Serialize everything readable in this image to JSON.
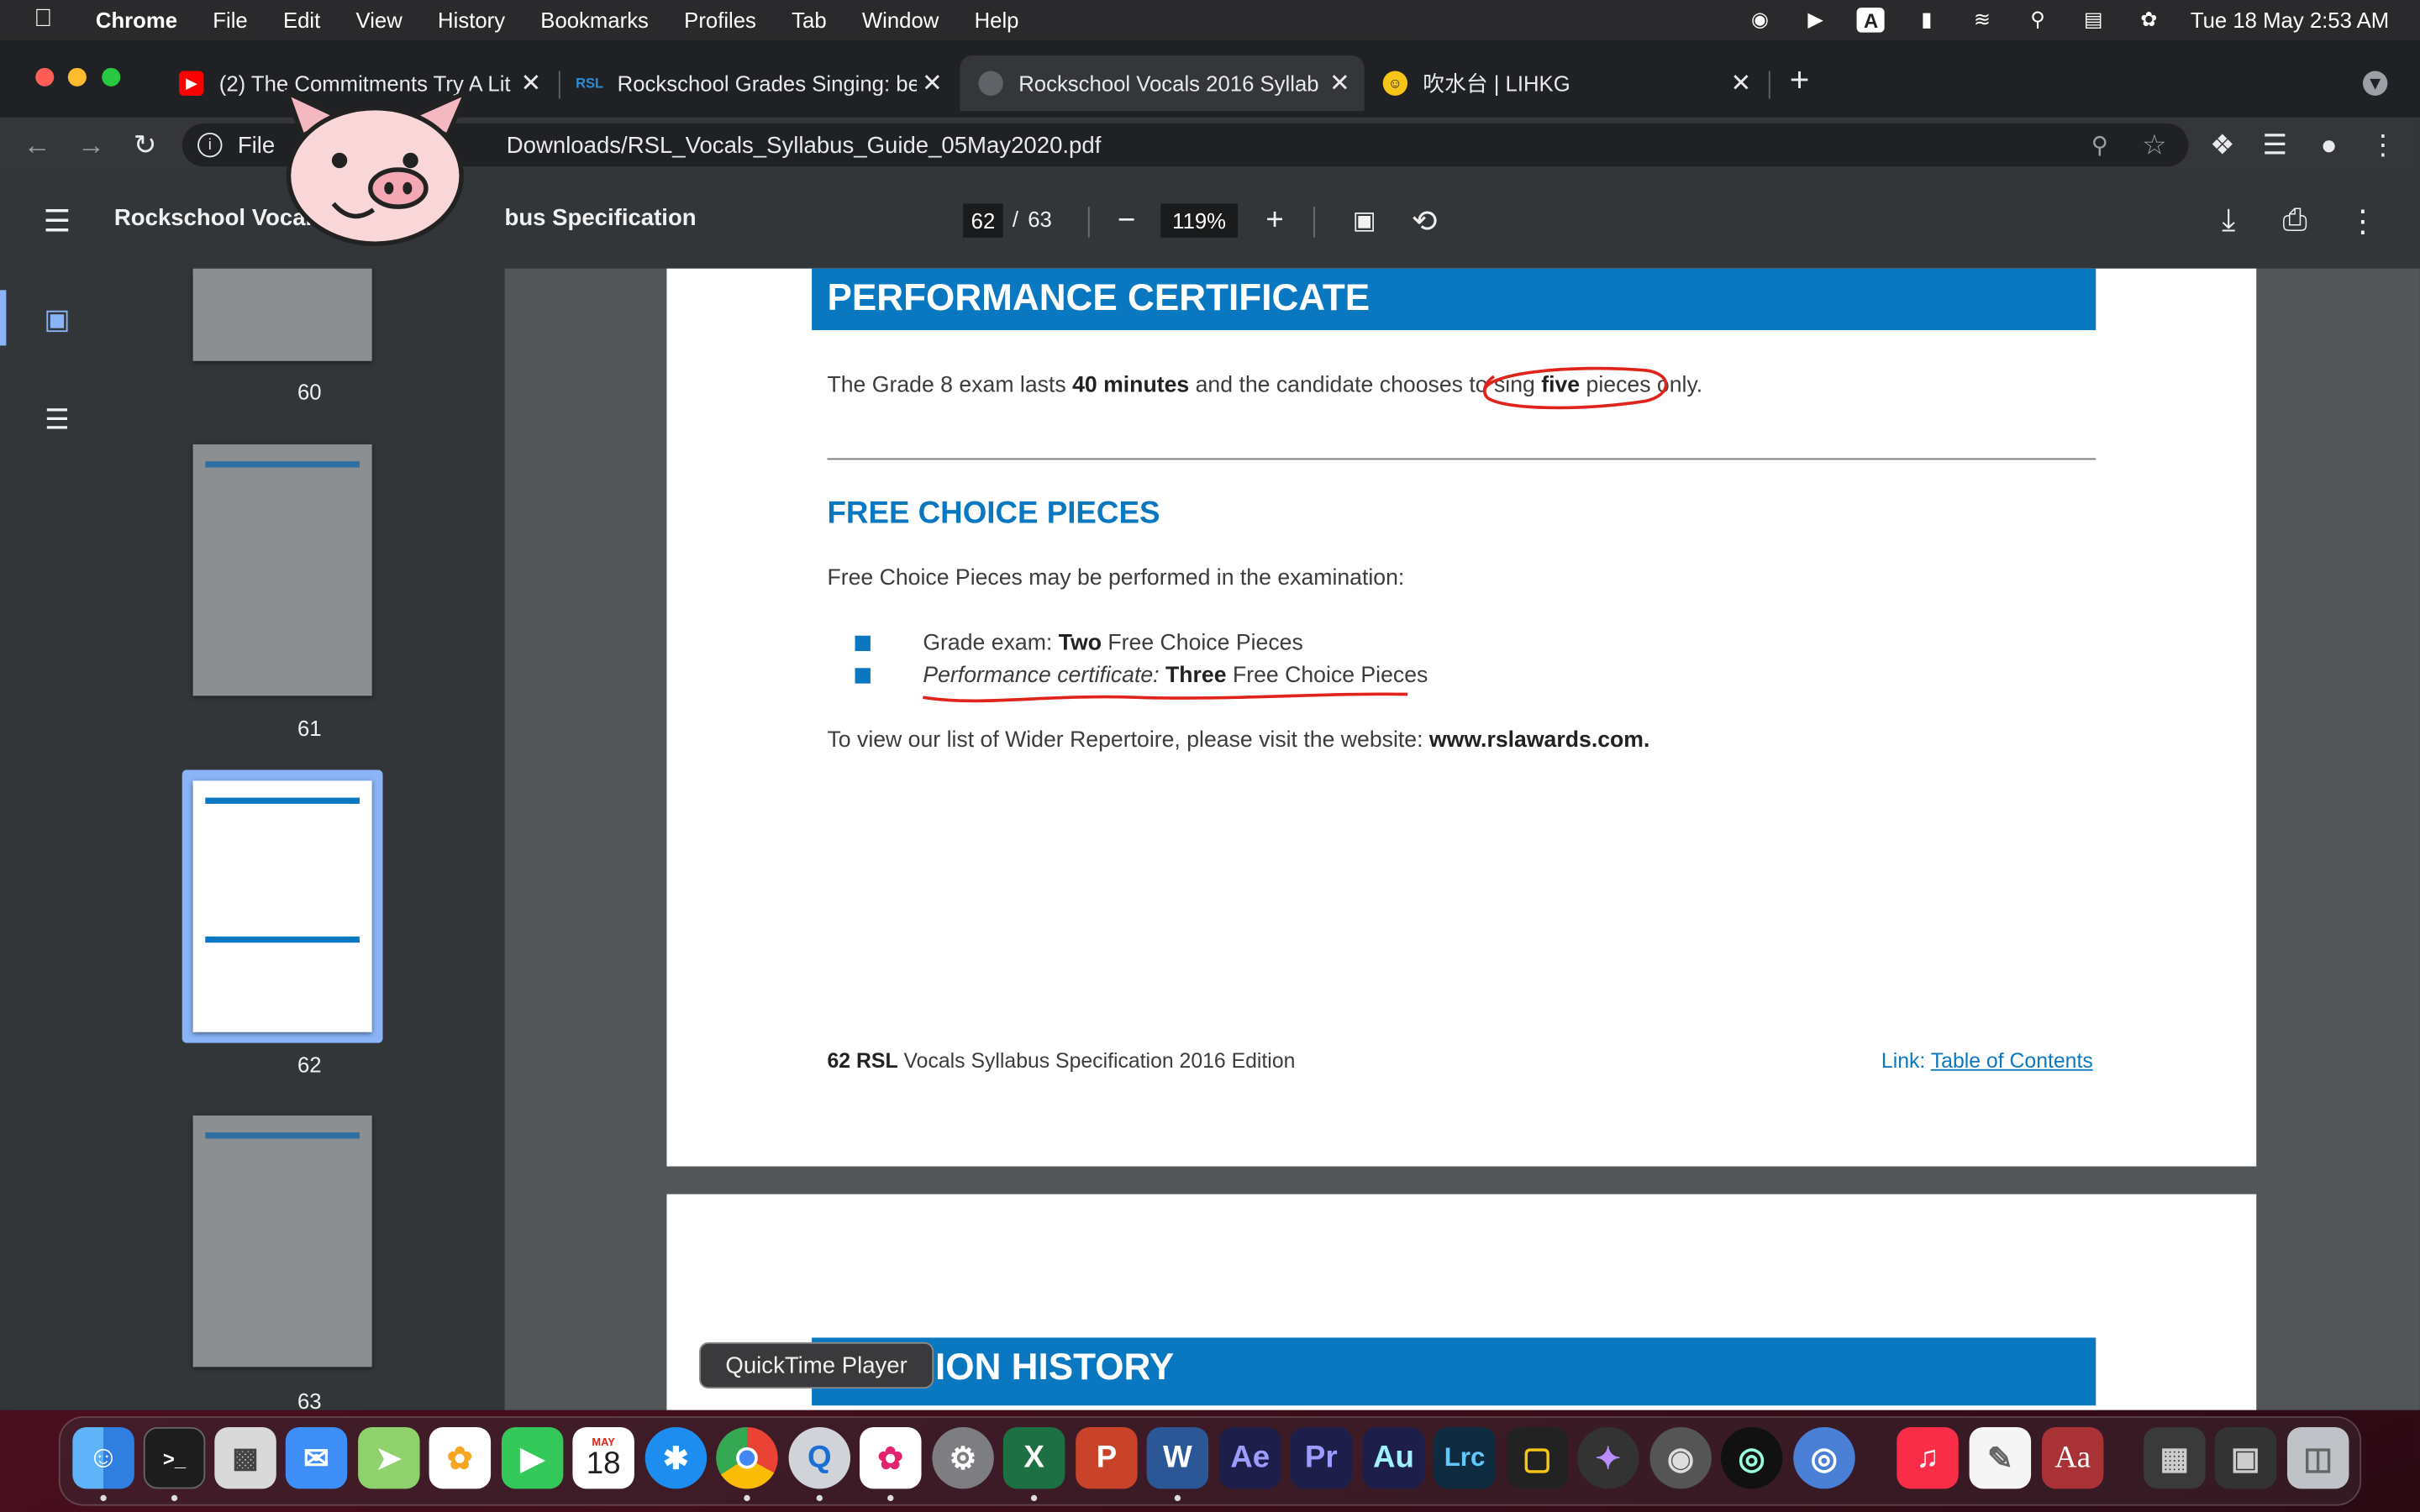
{
  "menubar": {
    "app": "Chrome",
    "items": [
      "File",
      "Edit",
      "View",
      "History",
      "Bookmarks",
      "Profiles",
      "Tab",
      "Window",
      "Help"
    ],
    "clock": "Tue 18 May  2:53 AM",
    "input_source": "A"
  },
  "tabs": [
    {
      "title": "(2) The Commitments Try A Lit",
      "favicon": "youtube-icon"
    },
    {
      "title": "Rockschool Grades Singing: be",
      "favicon": "rsl-icon",
      "favicon_text": "RSL"
    },
    {
      "title": "Rockschool Vocals 2016 Syllab",
      "favicon": "globe-icon",
      "active": true
    },
    {
      "title": "吹水台 | LIHKG",
      "favicon": "lihkg-icon"
    }
  ],
  "omnibox": {
    "prefix": "File",
    "path": "Downloads/RSL_Vocals_Syllabus_Guide_05May2020.pdf"
  },
  "pdf": {
    "title_left": "Rockschool Vocals 2",
    "title_right": "bus Specification",
    "page_current": "62",
    "page_sep": "/",
    "page_total": "63",
    "zoom": "119%"
  },
  "thumbnails": [
    "60",
    "61",
    "62",
    "63"
  ],
  "page62": {
    "heading": "PERFORMANCE CERTIFICATE",
    "line1_a": "The Grade 8 exam lasts ",
    "line1_b": "40 minutes",
    "line1_c": " and the candidate chooses to sing ",
    "line1_d": "five",
    "line1_e": " pieces only.",
    "subheading": "FREE CHOICE PIECES",
    "intro": "Free Choice Pieces may be performed in the examination:",
    "bullet1_a": "Grade exam: ",
    "bullet1_b": "Two",
    "bullet1_c": " Free Choice Pieces",
    "bullet2_a": "Performance certificate: ",
    "bullet2_b": "Three",
    "bullet2_c": " Free Choice Pieces",
    "web_a": "To view our list of Wider Repertoire, please visit the website: ",
    "web_b": "www.rslawards.com.",
    "footer_num": "62",
    "footer_brand": "RSL",
    "footer_text": "Vocals Syllabus Specification 2016 Edition",
    "footer_link_label": "Link: ",
    "footer_link": "Table of Contents"
  },
  "page63": {
    "heading_partial": "ION HISTORY"
  },
  "tooltip": "QuickTime Player",
  "dock": {
    "calendar_month": "MAY",
    "calendar_day": "18",
    "apps": [
      "Finder",
      "Terminal",
      "Launchpad",
      "Mail",
      "Maps",
      "Photos",
      "FaceTime",
      "Calendar",
      "Safari",
      "Chrome",
      "QuickTime Player",
      "Pinwheel",
      "System Preferences",
      "Excel",
      "PowerPoint",
      "Word",
      "After Effects",
      "Premiere Pro",
      "Audition",
      "Lightroom Classic",
      "Final Cut Pro",
      "Motion",
      "Compressor",
      "Logic",
      "Music",
      "TextEdit",
      "Dictionary",
      "Photo Booth",
      "Screenshot",
      "Trash"
    ],
    "labels": {
      "ae": "Ae",
      "pr": "Pr",
      "au": "Au",
      "lrc": "Lrc",
      "dict": "Aa",
      "x": "X",
      "p": "P",
      "w": "W"
    }
  }
}
